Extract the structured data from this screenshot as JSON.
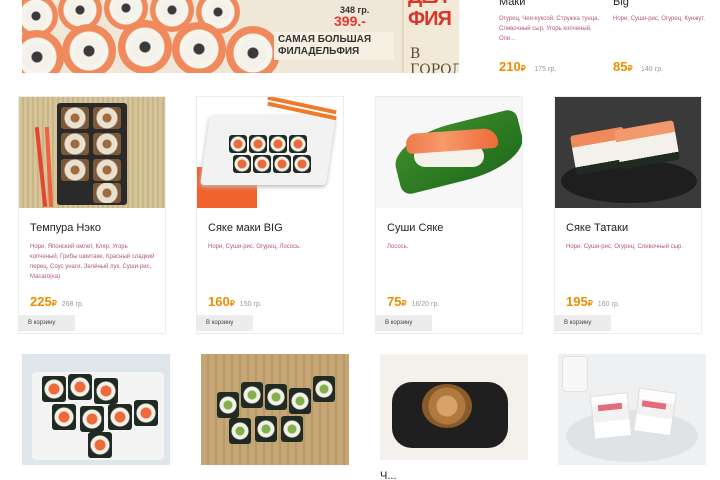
{
  "banner": {
    "price_old": "348 гр.",
    "price_new": "399.-",
    "promo_text": "САМАЯ БОЛЬШАЯ ФИЛАДЕЛЬФИЯ",
    "brand_line1": "ДЕЛ",
    "brand_line2": "ФИЯ",
    "brand_line3": "В ГОРОД"
  },
  "top_products": [
    {
      "title": "Маки",
      "desc": "Огурец, Чеи-куксой, Стружка тунца, Сливочный сыр, Угорь копченый, Опи...",
      "price": "210",
      "currency": "₽",
      "weight": "175 гр."
    },
    {
      "title": "Big",
      "desc": "Нори, Суши-рис, Огурец, Кунжут.",
      "price": "85",
      "currency": "₽",
      "weight": "140 гр."
    }
  ],
  "products": [
    {
      "name": "Темпура Нэко",
      "desc": "Нори, Японский омлет, Кляр, Угорь копченый, Грибы шиитаке, Красный сладкий перец, Соус унаги, Зелёный лук, Суши-рис, Масаго(ка)",
      "price": "225",
      "currency": "₽",
      "weight": "268 гр.",
      "button": "В корзину"
    },
    {
      "name": "Сяке маки BIG",
      "desc": "Нори, Суши-рис, Огурец, Лосось.",
      "price": "160",
      "currency": "₽",
      "weight": "150 гр.",
      "button": "В корзину"
    },
    {
      "name": "Суши Сяке",
      "desc": "Лосось.",
      "price": "75",
      "currency": "₽",
      "weight": "16/20 гр.",
      "button": "В корзину"
    },
    {
      "name": "Сяке Татаки",
      "desc": "Нори, Суши-рис, Огурец, Сливочный сыр.",
      "price": "195",
      "currency": "₽",
      "weight": "160 гр.",
      "button": "В корзину"
    }
  ],
  "row2_partial_title": "Ч..."
}
